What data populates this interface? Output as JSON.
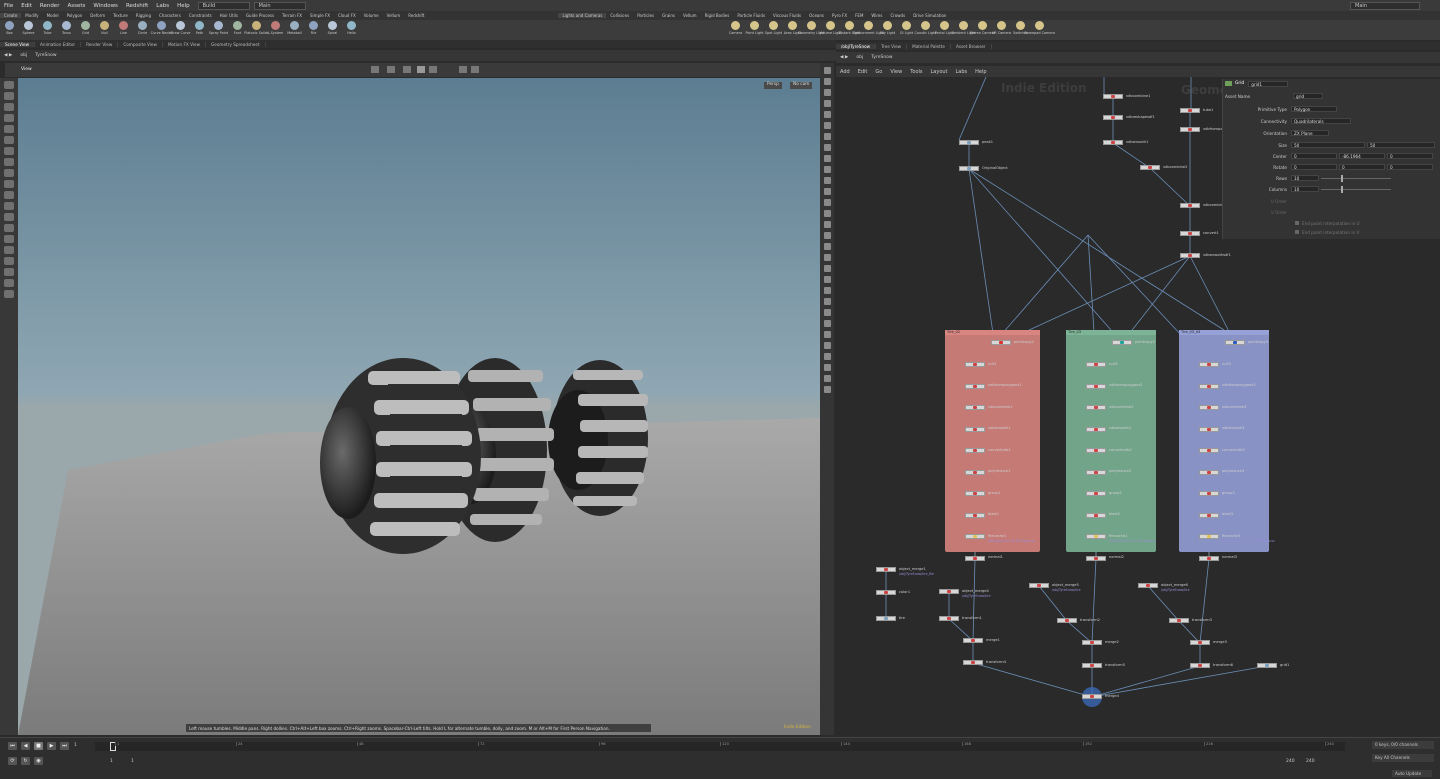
{
  "menubar": {
    "items": [
      "File",
      "Edit",
      "Render",
      "Assets",
      "Windows",
      "Redshift",
      "Labs",
      "Help"
    ],
    "desktop": "Build",
    "context": "Main",
    "right_context": "Main"
  },
  "shelf_left": {
    "tabs": [
      "Create",
      "Modify",
      "Model",
      "Polygon",
      "Deform",
      "Texture",
      "Rigging",
      "Characters",
      "Constraints",
      "Hair Utils",
      "Guide Process",
      "Terrain FX",
      "Simple FX",
      "Cloud FX",
      "Volume",
      "Vellum",
      "Redshift"
    ],
    "tools": [
      "Box",
      "Sphere",
      "Tube",
      "Torus",
      "Grid",
      "Null",
      "Line",
      "Circle",
      "Curve Bezier",
      "Draw Curve",
      "Path",
      "Spray Paint",
      "Font",
      "Platonic Solids",
      "L-System",
      "Metaball",
      "File",
      "Spiral",
      "Helix"
    ]
  },
  "shelf_right": {
    "tabs": [
      "Lights and Cameras",
      "Collisions",
      "Particles",
      "Grains",
      "Vellum",
      "Rigid Bodies",
      "Particle Fluids",
      "Viscous Fluids",
      "Oceans",
      "Pyro FX",
      "FEM",
      "Wires",
      "Crowds",
      "Drive Simulation"
    ],
    "tools": [
      "Camera",
      "Point Light",
      "Spot Light",
      "Area Light",
      "Geometry Light",
      "Volume Light",
      "Distant Light",
      "Environment Light",
      "Sky Light",
      "GI Light",
      "Caustic Light",
      "Portal Light",
      "Ambient Light",
      "Stereo Camera",
      "VR Camera",
      "Switcher",
      "Gamepad Camera"
    ]
  },
  "left_pane": {
    "tabs": [
      "Scene View",
      "Animation Editor",
      "Render View",
      "Composite View",
      "Motion FX View",
      "Geometry Spreadsheet"
    ],
    "path": [
      "obj",
      "TyreSnow"
    ],
    "view_label": "View",
    "persp": "Persp",
    "cam": "No cam",
    "status": "Left mouse tumbles. Middle pans. Right dollies. Ctrl+Alt+Left box zooms. Ctrl+Right zooms. Spacebar-Ctrl-Left tilts. Hold L for alternate tumble, dolly, and zoom.     M or Alt+M for First Person Navigation.",
    "indie": "Indie Edition"
  },
  "right_pane": {
    "tabs": [
      "/obj/TyreSnow",
      "Tree View",
      "Material Palette",
      "Asset Browser"
    ],
    "path": [
      "obj",
      "TyreSnow"
    ],
    "menu": [
      "Add",
      "Edit",
      "Go",
      "View",
      "Tools",
      "Layout",
      "Labs",
      "Help"
    ],
    "watermark1": "Indie Edition",
    "watermark2": "Geometry"
  },
  "parms": {
    "header_type": "Grid",
    "header_name": "grid1",
    "asset_name_label": "Asset Name",
    "asset_name": "grid",
    "rows": [
      {
        "label": "Primitive Type",
        "value": "Polygon"
      },
      {
        "label": "Connectivity",
        "value": "Quadrilaterals"
      },
      {
        "label": "Orientation",
        "value": "ZX Plane"
      }
    ],
    "size": {
      "label": "Size",
      "a": "50",
      "b": "50"
    },
    "center": {
      "label": "Center",
      "a": "0",
      "b": "-86.1964",
      "c": "0"
    },
    "rotate": {
      "label": "Rotate",
      "a": "0",
      "b": "0",
      "c": "0"
    },
    "rows_count": {
      "label": "Rows",
      "value": "10"
    },
    "cols_count": {
      "label": "Columns",
      "value": "10"
    },
    "u_order": "U Order",
    "v_order": "V Order",
    "chk1": "End point interpolation in U",
    "chk2": "End point interpolation in V"
  },
  "network": {
    "top_nodes": [
      {
        "name": "vdbcombine1"
      },
      {
        "name": "vdbreshapesdf1"
      },
      {
        "name": "vdbsmooth1"
      },
      {
        "name": "vdbcombine2"
      },
      {
        "name": "tube1"
      },
      {
        "name": "vdbfrompolygons1"
      },
      {
        "name": "vdbcombine3"
      },
      {
        "name": "convert1"
      },
      {
        "name": "vdbsmoothsdf1"
      },
      {
        "name": "peak1"
      },
      {
        "name": "OriginalObject"
      }
    ],
    "boxes": [
      {
        "title": "Tire_02",
        "color": "#c57a76",
        "nodes": [
          "pointcopy1",
          "null1",
          "vdbfrompolygons1",
          "vdbcombine1",
          "vdbsmooth1",
          "convertvdb1",
          "polyreduce1",
          "group1",
          "blast1",
          "filecache1",
          "normal1"
        ],
        "cache_path": "$HIP/geo/Tire_02.$F4.bgeo.sc"
      },
      {
        "title": "Tire_03",
        "color": "#72a489",
        "nodes": [
          "pointcopy2",
          "null2",
          "vdbfrompolygons2",
          "vdbcombine2",
          "vdbsmooth2",
          "convertvdb2",
          "polyreduce2",
          "group2",
          "blast2",
          "filecache2",
          "normal2"
        ],
        "cache_path": "$HIP/geo/Tire_03.$F4.bgeo.sc"
      },
      {
        "title": "Tire_03_04",
        "color": "#8892c4",
        "nodes": [
          "pointcopy3",
          "null3",
          "vdbfrompolygons3",
          "vdbcombine3",
          "vdbsmooth3",
          "convertvdb3",
          "polyreduce3",
          "group3",
          "blast3",
          "filecache3",
          "normal3"
        ],
        "cache_path": "$HIP/geo/Tire_03_04.$F4.bgeo.sc"
      }
    ],
    "bottom_nodes": [
      {
        "name": "object_merge1",
        "sub": "/obj/TyreSnow/tire_file"
      },
      {
        "name": "color1"
      },
      {
        "name": "tire"
      },
      {
        "name": "object_merge4",
        "sub": "/obj/TyreSnow/tire"
      },
      {
        "name": "transform1"
      },
      {
        "name": "merge1"
      },
      {
        "name": "transform4"
      },
      {
        "name": "object_merge5",
        "sub": "/obj/TyreSnow/tire"
      },
      {
        "name": "transform2"
      },
      {
        "name": "merge2"
      },
      {
        "name": "transform5"
      },
      {
        "name": "object_merge6",
        "sub": "/obj/TyreSnow/tire"
      },
      {
        "name": "transform3"
      },
      {
        "name": "merge3"
      },
      {
        "name": "transform6"
      },
      {
        "name": "grid1"
      },
      {
        "name": "merge4"
      }
    ]
  },
  "timeline": {
    "frame": "1",
    "start": "1",
    "start2": "1",
    "end": "240",
    "end2": "240",
    "ticks": [
      "1",
      "24",
      "48",
      "72",
      "96",
      "120",
      "144",
      "168",
      "192",
      "216",
      "240"
    ],
    "keys": "0 keys, 0/0 channels",
    "key_all": "Key All Channels",
    "auto": "Auto Update"
  }
}
